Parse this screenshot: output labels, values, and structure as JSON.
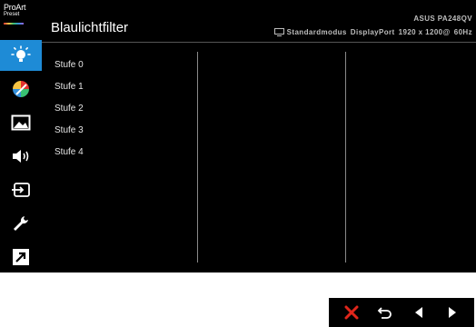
{
  "branding": {
    "logo_line1": "ProArt",
    "logo_line2": "Preset"
  },
  "sidebar": {
    "items": [
      {
        "icon": "bulb-icon",
        "active": true
      },
      {
        "icon": "palette-icon",
        "active": false
      },
      {
        "icon": "image-icon",
        "active": false
      },
      {
        "icon": "speaker-icon",
        "active": false
      },
      {
        "icon": "input-select-icon",
        "active": false
      },
      {
        "icon": "wrench-icon",
        "active": false
      },
      {
        "icon": "shortcut-icon",
        "active": false
      }
    ]
  },
  "header": {
    "title": "Blaulichtfilter",
    "model": "ASUS PA248QV",
    "status": {
      "mode": "Standardmodus",
      "input": "DisplayPort",
      "resolution": "1920 x 1200@",
      "refresh": "60Hz"
    }
  },
  "menu": {
    "options": [
      "Stufe 0",
      "Stufe 1",
      "Stufe 2",
      "Stufe 3",
      "Stufe 4"
    ]
  },
  "footer": {
    "buttons": [
      "close-icon",
      "back-icon",
      "left-arrow-icon",
      "right-arrow-icon"
    ]
  },
  "colors": {
    "accent": "#1e8bd6",
    "background": "#000000",
    "close": "#e0261b"
  }
}
